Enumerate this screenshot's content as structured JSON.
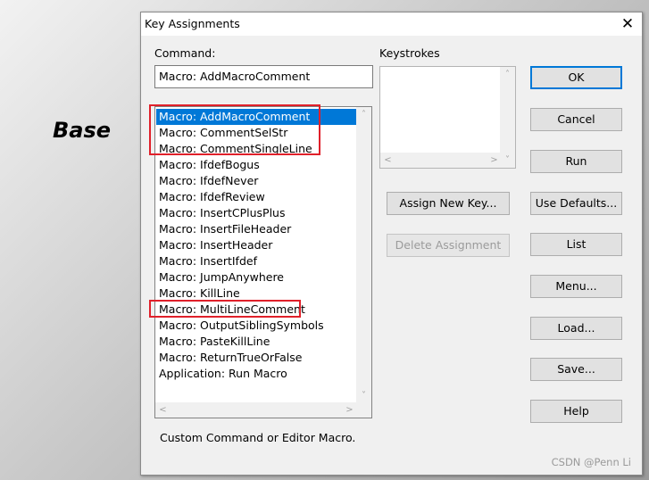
{
  "side_label": "Base",
  "dialog": {
    "title": "Key Assignments",
    "close_glyph": "✕",
    "command_label": "Command:",
    "command_value": "Macro: AddMacroComment",
    "keystrokes_label": "Keystrokes",
    "description": "Custom Command or Editor Macro."
  },
  "commands": [
    {
      "label": "Macro: AddMacroComment",
      "selected": true
    },
    {
      "label": "Macro: CommentSelStr"
    },
    {
      "label": "Macro: CommentSingleLine"
    },
    {
      "label": "Macro: IfdefBogus"
    },
    {
      "label": "Macro: IfdefNever"
    },
    {
      "label": "Macro: IfdefReview"
    },
    {
      "label": "Macro: InsertCPlusPlus"
    },
    {
      "label": "Macro: InsertFileHeader"
    },
    {
      "label": "Macro: InsertHeader"
    },
    {
      "label": "Macro: InsertIfdef"
    },
    {
      "label": "Macro: JumpAnywhere"
    },
    {
      "label": "Macro: KillLine"
    },
    {
      "label": "Macro: MultiLineComment"
    },
    {
      "label": "Macro: OutputSiblingSymbols"
    },
    {
      "label": "Macro: PasteKillLine"
    },
    {
      "label": "Macro: ReturnTrueOrFalse"
    },
    {
      "label": "Application: Run Macro"
    }
  ],
  "buttons": {
    "ok": "OK",
    "cancel": "Cancel",
    "run": "Run",
    "use_defaults": "Use Defaults...",
    "list": "List",
    "menu": "Menu...",
    "load": "Load...",
    "save": "Save...",
    "help": "Help",
    "assign_new_key": "Assign New Key...",
    "delete_assignment": "Delete Assignment"
  },
  "scroll_arrows": {
    "up": "˄",
    "down": "˅",
    "left": "<",
    "right": ">"
  },
  "watermark": "CSDN @Penn Li",
  "colors": {
    "selection": "#0078d7",
    "highlight_box": "#e0202a",
    "default_button_border": "#0078d7"
  }
}
